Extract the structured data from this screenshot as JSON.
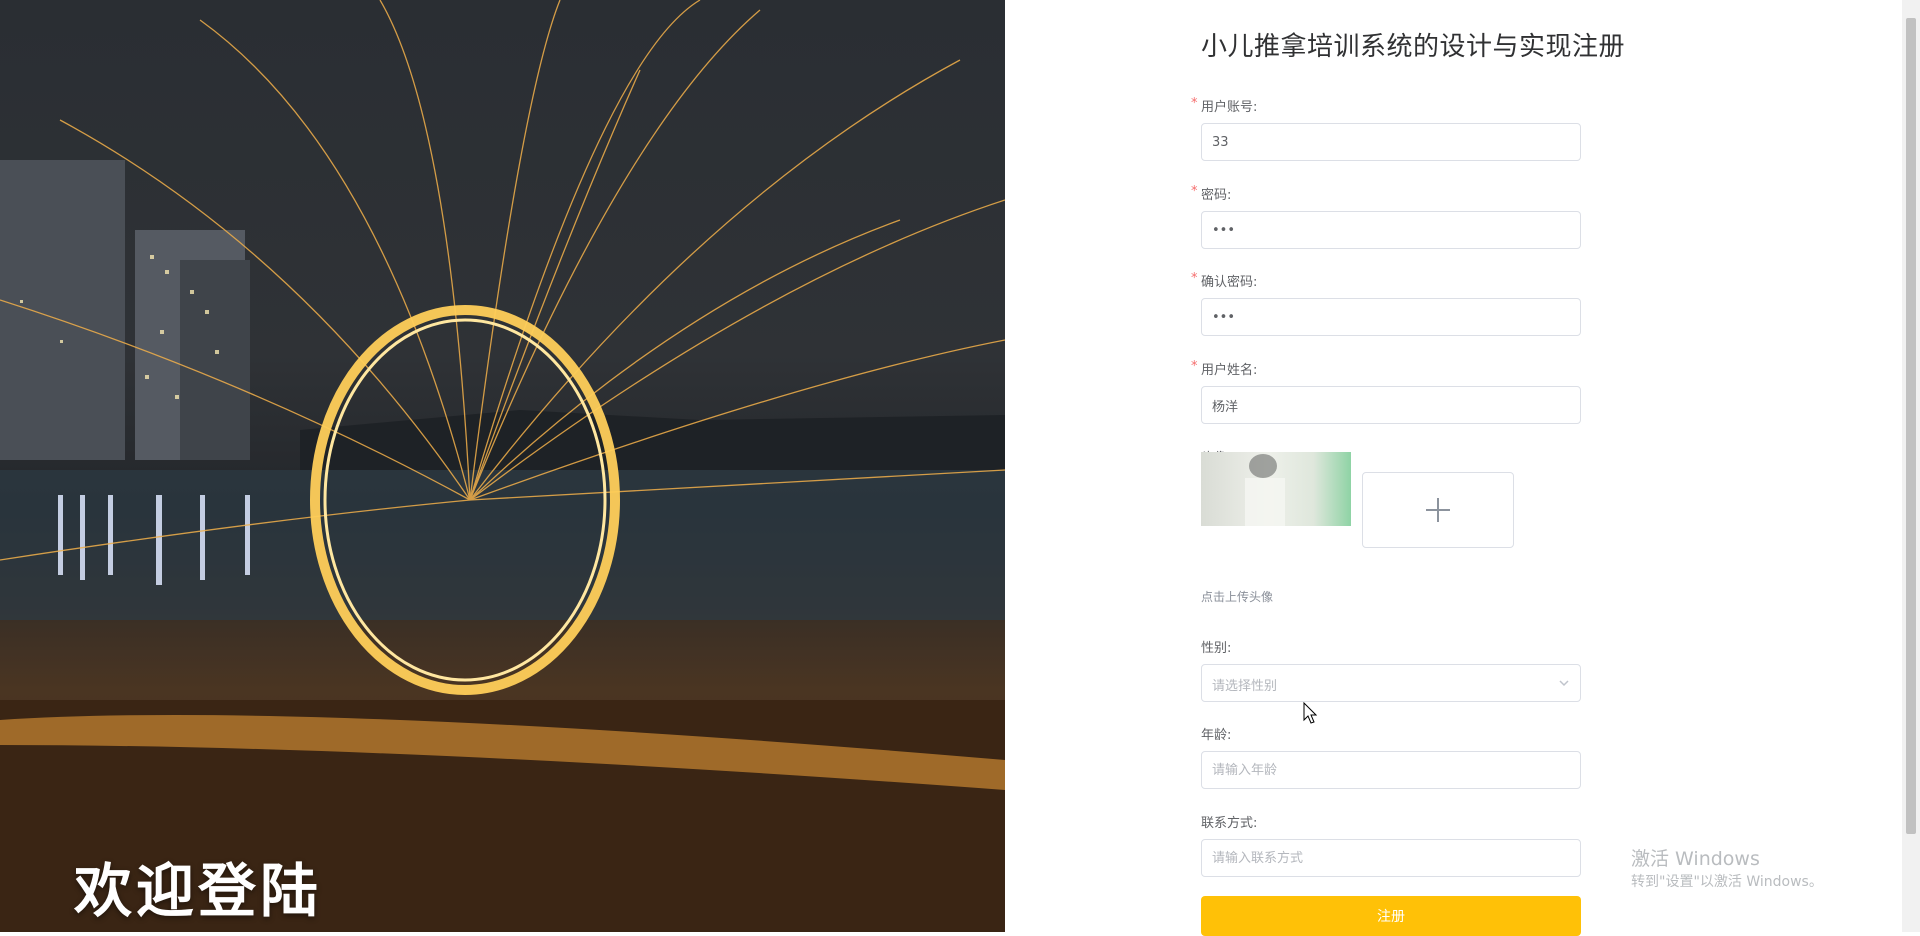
{
  "hero": {
    "title": "欢迎登陆"
  },
  "form": {
    "title": "小儿推拿培训系统的设计与实现注册",
    "required_mark": "*",
    "fields": {
      "account": {
        "label": "用户账号:",
        "value": "33"
      },
      "password": {
        "label": "密码:",
        "value": "•••"
      },
      "confirm_password": {
        "label": "确认密码:",
        "value": "•••"
      },
      "name": {
        "label": "用户姓名:",
        "value": "杨洋"
      },
      "avatar": {
        "label": "头像:",
        "upload_hint": "点击上传头像"
      },
      "gender": {
        "label": "性别:",
        "placeholder": "请选择性别"
      },
      "age": {
        "label": "年龄:",
        "placeholder": "请输入年龄"
      },
      "contact": {
        "label": "联系方式:",
        "placeholder": "请输入联系方式"
      }
    },
    "submit_label": "注册"
  },
  "watermark": {
    "line1": "激活 Windows",
    "line2": "转到\"设置\"以激活 Windows。"
  },
  "colors": {
    "accent": "#ffc107",
    "required": "#f56c6c",
    "border": "#dcdfe6"
  }
}
